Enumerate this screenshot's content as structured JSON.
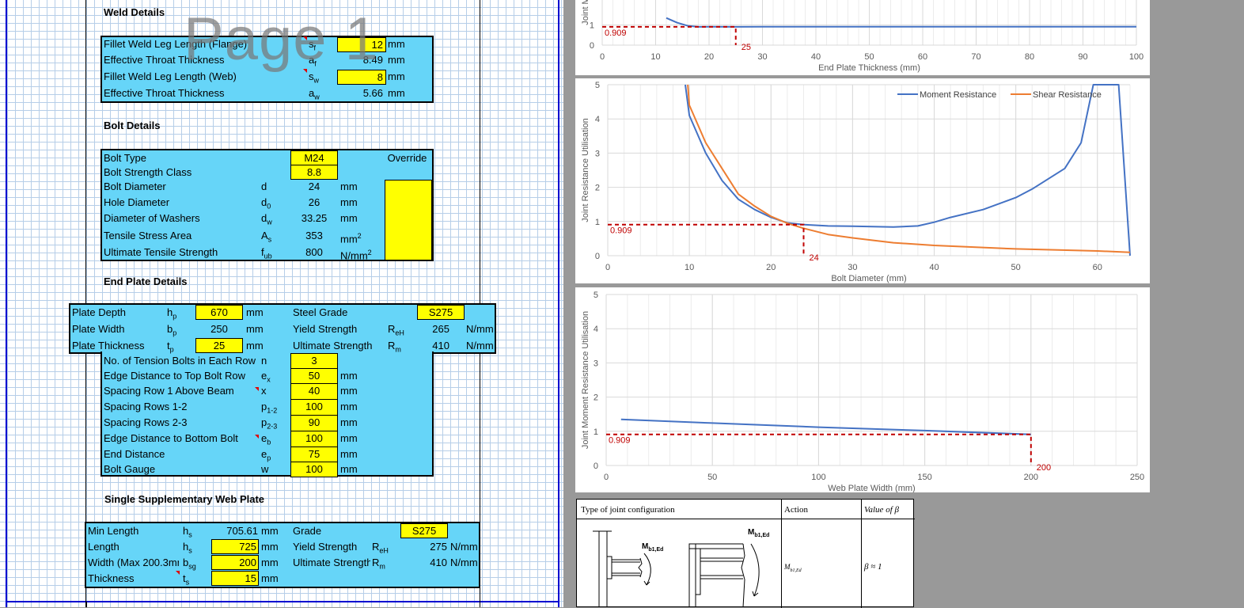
{
  "watermark": "Page 1",
  "weld": {
    "title": "Weld Details",
    "rows": [
      {
        "label": "Fillet Weld Leg Length (Flange)",
        "sym": "s",
        "sub": "f",
        "value": "12",
        "unit": "mm"
      },
      {
        "label": "Effective Throat Thickness",
        "sym": "a",
        "sub": "f",
        "value": "8.49",
        "unit": "mm"
      },
      {
        "label": "Fillet Weld Leg Length (Web)",
        "sym": "s",
        "sub": "w",
        "value": "8",
        "unit": "mm"
      },
      {
        "label": "Effective Throat Thickness",
        "sym": "a",
        "sub": "w",
        "value": "5.66",
        "unit": "mm"
      }
    ]
  },
  "bolt": {
    "title": "Bolt Details",
    "override": "Override",
    "rows": [
      {
        "label": "Bolt Type",
        "value": "M24"
      },
      {
        "label": "Bolt Strength Class",
        "value": "8.8"
      },
      {
        "label": "Bolt Diameter",
        "sym": "d",
        "sub": "",
        "value": "24",
        "unit": "mm"
      },
      {
        "label": "Hole Diameter",
        "sym": "d",
        "sub": "0",
        "value": "26",
        "unit": "mm"
      },
      {
        "label": "Diameter of Washers",
        "sym": "d",
        "sub": "w",
        "value": "33.25",
        "unit": "mm"
      },
      {
        "label": "Tensile Stress Area",
        "sym": "A",
        "sub": "s",
        "value": "353",
        "unit": "mm",
        "sup": "2"
      },
      {
        "label": "Ultimate Tensile Strength",
        "sym": "f",
        "sub": "ub",
        "value": "800",
        "unit": "N/mm",
        "sup": "2"
      }
    ]
  },
  "plate": {
    "title": "End Plate Details",
    "left": [
      {
        "label": "Plate Depth",
        "sym": "h",
        "sub": "p",
        "value": "670",
        "unit": "mm"
      },
      {
        "label": "Plate Width",
        "sym": "b",
        "sub": "p",
        "value": "250",
        "unit": "mm"
      },
      {
        "label": "Plate Thickness",
        "sym": "t",
        "sub": "p",
        "value": "25",
        "unit": "mm"
      }
    ],
    "right": [
      {
        "label": "Steel Grade",
        "value": "S275"
      },
      {
        "label": "Yield Strength",
        "sym": "R",
        "sub": "eH",
        "value": "265",
        "unit": "N/mm"
      },
      {
        "label": "Ultimate Strength",
        "sym": "R",
        "sub": "m",
        "value": "410",
        "unit": "N/mm"
      }
    ],
    "rows": [
      {
        "label": "No. of Tension Bolts in Each Row",
        "sym": "n",
        "sub": "",
        "value": "3",
        "unit": ""
      },
      {
        "label": "Edge Distance to Top Bolt Row",
        "sym": "e",
        "sub": "x",
        "value": "50",
        "unit": "mm"
      },
      {
        "label": "Spacing Row 1 Above Beam",
        "sym": "x",
        "sub": "",
        "value": "40",
        "unit": "mm"
      },
      {
        "label": "Spacing Rows 1-2",
        "sym": "p",
        "sub": "1-2",
        "value": "100",
        "unit": "mm"
      },
      {
        "label": "Spacing Rows 2-3",
        "sym": "p",
        "sub": "2-3",
        "value": "90",
        "unit": "mm"
      },
      {
        "label": "Edge Distance to Bottom Bolt",
        "sym": "e",
        "sub": "b",
        "value": "100",
        "unit": "mm"
      },
      {
        "label": "End Distance",
        "sym": "e",
        "sub": "p",
        "value": "75",
        "unit": "mm"
      },
      {
        "label": "Bolt Gauge",
        "sym": "w",
        "sub": "",
        "value": "100",
        "unit": "mm"
      }
    ]
  },
  "web": {
    "title": "Single Supplementary Web Plate",
    "rows": [
      {
        "label": "Min Length",
        "sym": "h",
        "sub": "s",
        "value": "705.61",
        "unit": "mm",
        "rlabel": "Grade",
        "rvalue": "S275"
      },
      {
        "label": "Length",
        "sym": "h",
        "sub": "s",
        "value": "725",
        "unit": "mm",
        "rlabel": "Yield Strength",
        "rsym": "R",
        "rsub": "eH",
        "rvalue": "275",
        "runit": "N/mm"
      },
      {
        "label": "Width (Max 200.3mm)",
        "sym": "b",
        "sub": "sg",
        "value": "200",
        "unit": "mm",
        "rlabel": "Ultimate Strength",
        "rsym": "R",
        "rsub": "m",
        "rvalue": "410",
        "runit": "N/mm"
      },
      {
        "label": "Thickness",
        "sym": "t",
        "sub": "s",
        "value": "15",
        "unit": "mm"
      }
    ]
  },
  "chart_data": [
    {
      "type": "line",
      "xlabel": "End Plate Thickness (mm)",
      "ylabel": "Joint M",
      "xlim": [
        0,
        100
      ],
      "xticks": [
        0,
        10,
        20,
        30,
        40,
        50,
        60,
        70,
        80,
        90,
        100
      ],
      "yticks": [
        0,
        1
      ],
      "series": [
        {
          "values": [
            [
              12,
              1.35
            ],
            [
              14,
              1.12
            ],
            [
              16,
              0.96
            ],
            [
              18,
              0.91
            ],
            [
              20,
              0.915
            ],
            [
              25,
              0.909
            ],
            [
              30,
              0.912
            ],
            [
              50,
              0.912
            ],
            [
              100,
              0.912
            ]
          ]
        }
      ],
      "reference": {
        "y": 0.909,
        "x": 25,
        "ylabel": "0.909",
        "xlabel": "25"
      }
    },
    {
      "type": "line",
      "xlabel": "Bolt Diameter (mm)",
      "ylabel": "Joint Resistance Utilisation",
      "xlim": [
        0,
        64
      ],
      "ylim": [
        0,
        5
      ],
      "xticks": [
        0,
        10,
        20,
        30,
        40,
        50,
        60
      ],
      "yticks": [
        0,
        1,
        2,
        3,
        4,
        5
      ],
      "legend": "top-right",
      "series": [
        {
          "name": "Moment Resistance",
          "color": "#4472c4",
          "values": [
            [
              9.5,
              5
            ],
            [
              10,
              4.1
            ],
            [
              12,
              3
            ],
            [
              14,
              2.2
            ],
            [
              16,
              1.65
            ],
            [
              18,
              1.35
            ],
            [
              20,
              1.12
            ],
            [
              22,
              0.96
            ],
            [
              24,
              0.909
            ],
            [
              27,
              0.87
            ],
            [
              30,
              0.86
            ],
            [
              35,
              0.84
            ],
            [
              38,
              0.87
            ],
            [
              40,
              0.98
            ],
            [
              42,
              1.12
            ],
            [
              46,
              1.35
            ],
            [
              50,
              1.7
            ],
            [
              52,
              1.95
            ],
            [
              56,
              2.55
            ],
            [
              58,
              3.3
            ],
            [
              59.5,
              5
            ],
            [
              62.6,
              5
            ],
            [
              64,
              0
            ]
          ]
        },
        {
          "name": "Shear Resistance",
          "color": "#ed7d31",
          "values": [
            [
              9.8,
              5
            ],
            [
              10,
              4.4
            ],
            [
              12,
              3.3
            ],
            [
              14,
              2.55
            ],
            [
              16,
              1.8
            ],
            [
              18,
              1.45
            ],
            [
              20,
              1.15
            ],
            [
              22,
              0.95
            ],
            [
              24,
              0.8
            ],
            [
              27,
              0.62
            ],
            [
              30,
              0.52
            ],
            [
              35,
              0.38
            ],
            [
              40,
              0.3
            ],
            [
              50,
              0.2
            ],
            [
              60,
              0.14
            ],
            [
              64,
              0.1
            ]
          ]
        }
      ],
      "reference": {
        "y": 0.909,
        "x": 24,
        "ylabel": "0.909",
        "xlabel": "24"
      }
    },
    {
      "type": "line",
      "xlabel": "Web Plate Width (mm)",
      "ylabel": "Joint Moment Resistance Utilisation",
      "xlim": [
        0,
        250
      ],
      "ylim": [
        0,
        5
      ],
      "xticks": [
        0,
        50,
        100,
        150,
        200,
        250
      ],
      "yticks": [
        0,
        1,
        2,
        3,
        4,
        5
      ],
      "series": [
        {
          "color": "#4472c4",
          "values": [
            [
              7,
              1.35
            ],
            [
              50,
              1.24
            ],
            [
              100,
              1.12
            ],
            [
              150,
              1.02
            ],
            [
              200,
              0.909
            ]
          ]
        }
      ],
      "reference": {
        "y": 0.909,
        "x": 200,
        "ylabel": "0.909",
        "xlabel": "200"
      }
    }
  ],
  "beta_table": {
    "headers": [
      "Type of joint configuration",
      "Action",
      "Value of β"
    ],
    "moment1": "M",
    "moment1sub": "b1,Ed",
    "moment2": "M",
    "moment2sub": "b1,Ed",
    "action": "M",
    "actionsub": "b1,Ed",
    "value": "β ≈ 1"
  }
}
